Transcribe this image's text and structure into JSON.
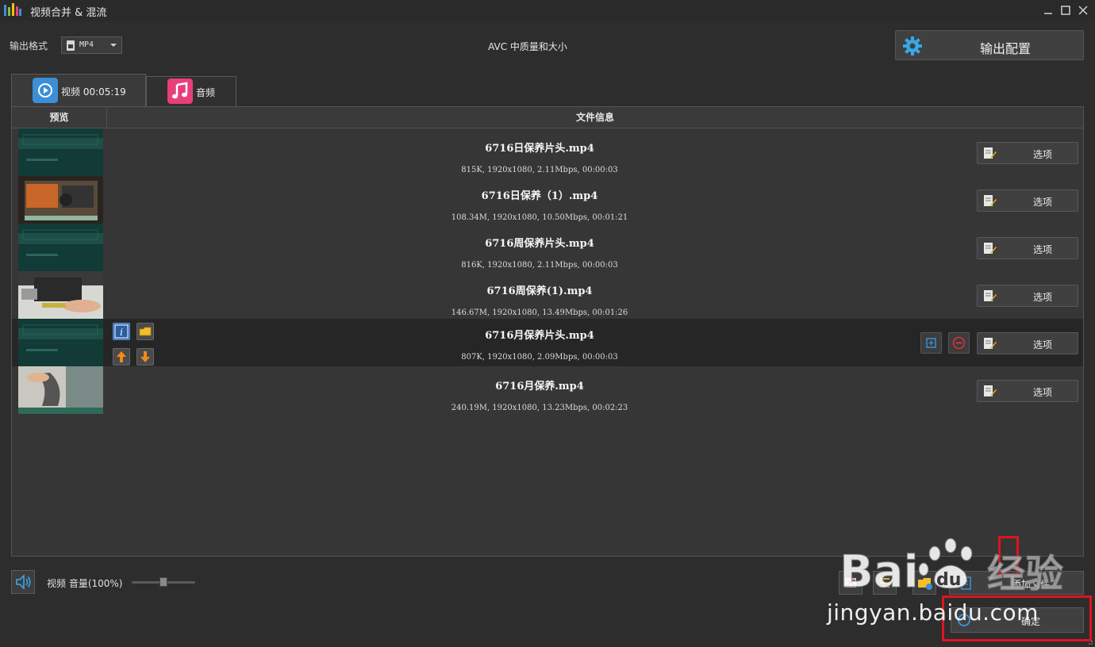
{
  "window": {
    "title": "视频合并 & 混流"
  },
  "toolbar": {
    "format_label": "输出格式",
    "format_value": "MP4",
    "quality_text": "AVC 中质量和大小",
    "config_label": "输出配置"
  },
  "tabs": [
    {
      "label": "视频 00:05:19"
    },
    {
      "label": "音频"
    }
  ],
  "table": {
    "headers": {
      "preview": "预览",
      "info": "文件信息"
    },
    "option_label": "选项",
    "rows": [
      {
        "name": "6716日保养片头.mp4",
        "meta": "815K, 1920x1080, 2.11Mbps, 00:00:03"
      },
      {
        "name": "6716日保养（1）.mp4",
        "meta": "108.34M, 1920x1080, 10.50Mbps, 00:01:21"
      },
      {
        "name": "6716周保养片头.mp4",
        "meta": "816K, 1920x1080, 2.11Mbps, 00:00:03"
      },
      {
        "name": "6716周保养(1).mp4",
        "meta": "146.67M, 1920x1080, 13.49Mbps, 00:01:26"
      },
      {
        "name": "6716月保养片头.mp4",
        "meta": "807K, 1920x1080, 2.09Mbps, 00:00:03"
      },
      {
        "name": "6716月保养.mp4",
        "meta": "240.19M, 1920x1080, 13.23Mbps, 00:02:23"
      }
    ]
  },
  "bottom": {
    "volume_label": "视频 音量(100%)",
    "volume_level": 0.5,
    "add_file_label": "添加文件",
    "ok_label": "确定"
  },
  "watermark": {
    "url": "jingyan.baidu.com"
  },
  "colors": {
    "accent": "#3b8fd6",
    "highlight": "#e0141e",
    "audio_tab": "#e83e7a",
    "arrows": "#f08a1a"
  }
}
